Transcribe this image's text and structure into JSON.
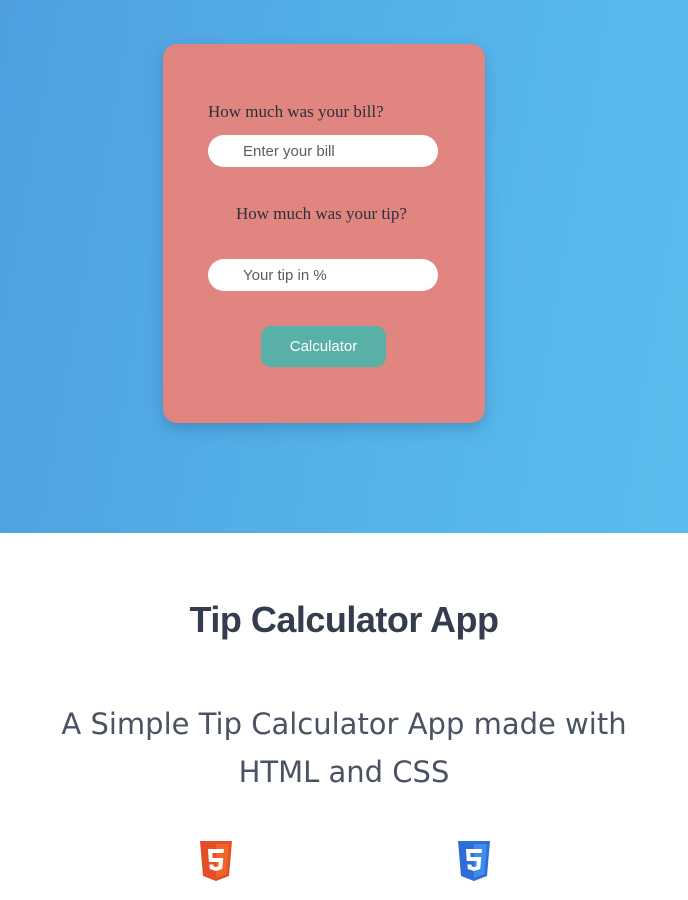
{
  "calculator": {
    "bill_question": "How much was your bill?",
    "bill_placeholder": "Enter your bill",
    "tip_question": "How much was your tip?",
    "tip_placeholder": "Your tip in %",
    "button_label": "Calculator"
  },
  "project": {
    "title": "Tip Calculator App",
    "description": "A Simple Tip Calculator App made with HTML and CSS",
    "tech_icons": [
      "html5-icon",
      "css3-icon"
    ]
  },
  "colors": {
    "hero_gradient_start": "#4f9fdf",
    "hero_gradient_end": "#58bdee",
    "card_background": "#e0857f",
    "button_background": "#58b0a6",
    "html5_brand": "#e34f26",
    "css3_brand": "#2f6ed6",
    "title_text": "#343c4d"
  }
}
